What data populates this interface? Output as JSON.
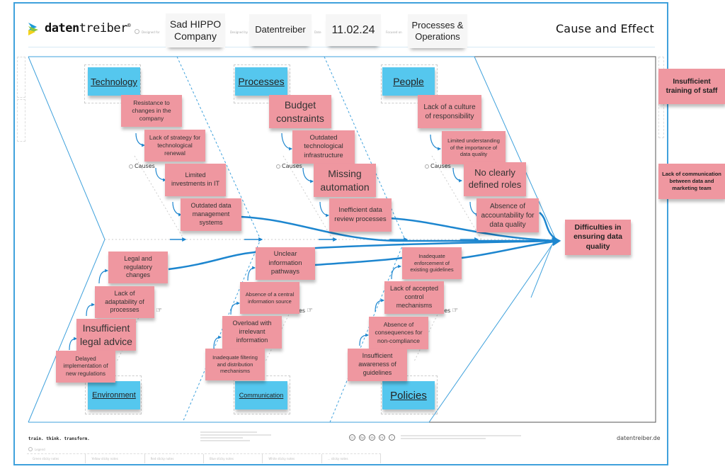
{
  "header": {
    "brand": {
      "prefix": "daten",
      "suffix": "treiber",
      "mark": "®"
    },
    "meta": [
      {
        "label": "Designed for",
        "value": "Sad HIPPO Company"
      },
      {
        "label": "Designed by",
        "value": "Datentreiber"
      },
      {
        "label": "Date",
        "value": "11.02.24"
      },
      {
        "label": "Focused on",
        "value": "Processes & Operations"
      }
    ],
    "title": "Cause and Effect"
  },
  "effect": "Difficulties in ensuring data quality",
  "causes_label": "Causes",
  "categories": {
    "technology": {
      "name": "Technology",
      "causes": [
        "Resistance to changes in the company",
        "Lack of strategy for technological renewal",
        "Limited investments in IT",
        "Outdated data management systems"
      ]
    },
    "processes": {
      "name": "Processes",
      "causes": [
        "Budget constraints",
        "Outdated technological infrastructure",
        "Missing automation",
        "Inefficient data review processes"
      ]
    },
    "people": {
      "name": "People",
      "causes": [
        "Lack of a culture of responsibility",
        "Limited understanding of the importance of data quality",
        "No clearly defined roles",
        "Absence of accountability for data quality"
      ]
    },
    "environment": {
      "name": "Environment",
      "causes": [
        "Legal and regulatory changes",
        "Lack of adaptability of processes",
        "Insufficient legal advice",
        "Delayed implementation of new regulations"
      ]
    },
    "communication": {
      "name": "Communication",
      "causes": [
        "Unclear information pathways",
        "Absence of a central information source",
        "Overload with irrelevant information",
        "Inadequate filtering and distribution mechanisms"
      ]
    },
    "policies": {
      "name": "Policies",
      "causes": [
        "Inadequate enforcement of existing guidelines",
        "Lack of accepted control mechanisms",
        "Absence of consequences for non-compliance",
        "Insufficient awareness of guidelines"
      ]
    }
  },
  "side_notes": [
    "Insufficient training of staff",
    "Lack of communication between data and marketing team"
  ],
  "footer": {
    "tagline": "train. think. transform.",
    "website": "datentreiber.de",
    "legend_label": "Legend",
    "legend_items": [
      "Green sticky notes",
      "Yellow sticky notes",
      "Red sticky notes",
      "Blue sticky notes",
      "White sticky notes",
      "... sticky notes"
    ],
    "license_icons": [
      "cc",
      "by",
      "sa",
      "nc",
      "i"
    ]
  },
  "colors": {
    "frame": "#3fa1dc",
    "cause_note": "#ef97a0",
    "category_note": "#55c7ee",
    "arrow": "#1d86cf"
  }
}
